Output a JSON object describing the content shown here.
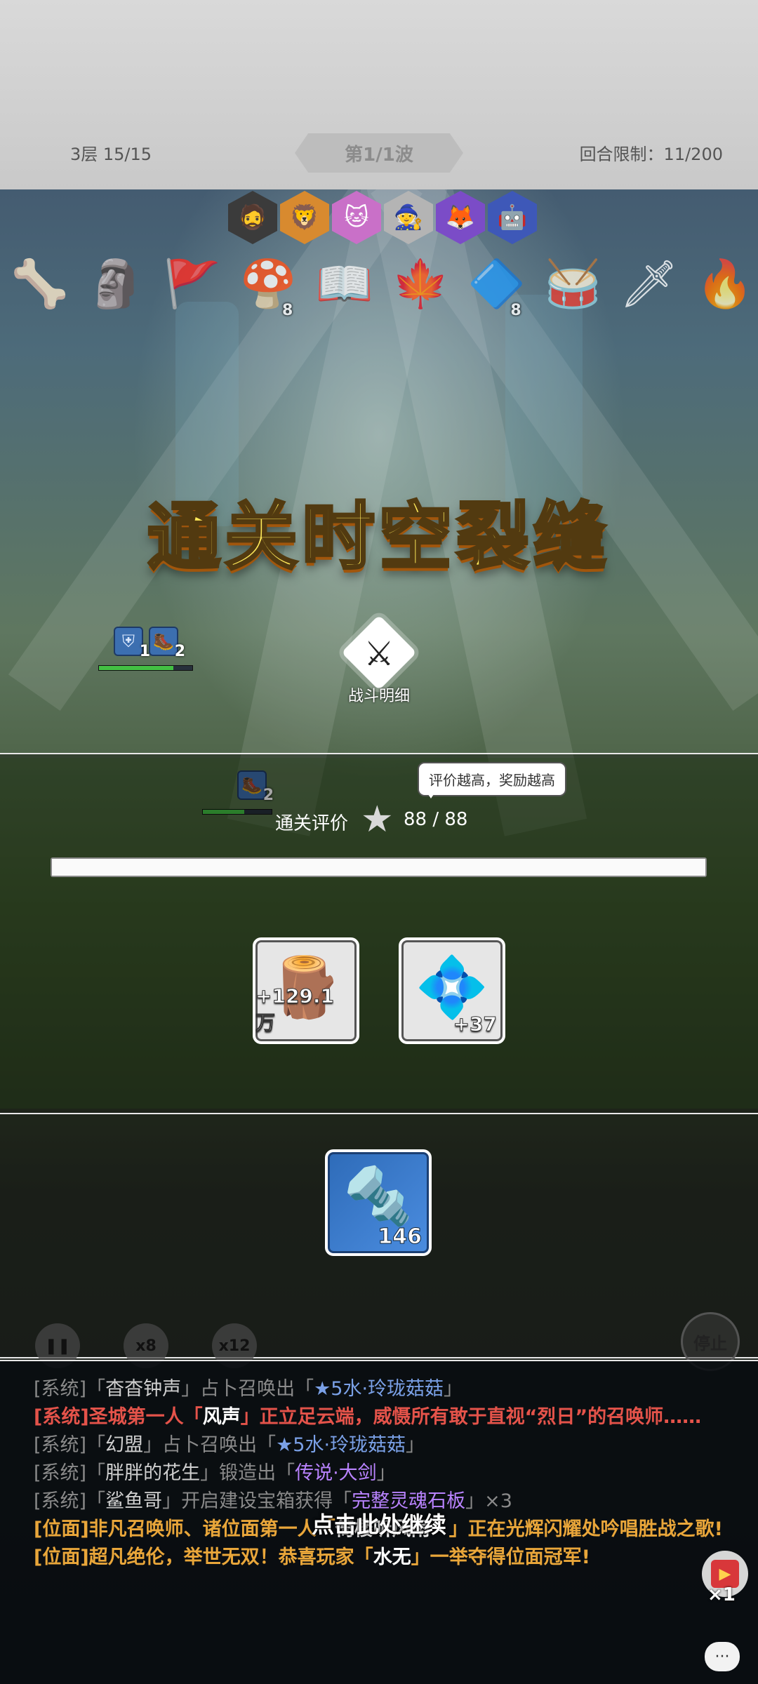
{
  "header": {
    "floor_info": "3层 15/15",
    "wave": "第1/1波",
    "round_limit": "回合限制：11/200"
  },
  "heroes": [
    {
      "icon": "🧔",
      "bg": "#3b3b3b"
    },
    {
      "icon": "🦁",
      "bg": "#d88a2f"
    },
    {
      "icon": "🐱",
      "bg": "#c970c8"
    },
    {
      "icon": "🧙",
      "bg": "#b4b4b4"
    },
    {
      "icon": "🦊",
      "bg": "#7b4cc7"
    },
    {
      "icon": "🤖",
      "bg": "#3e58b8"
    }
  ],
  "items": [
    {
      "icon": "🦴",
      "count": ""
    },
    {
      "icon": "🗿",
      "count": ""
    },
    {
      "icon": "🚩",
      "count": ""
    },
    {
      "icon": "🍄",
      "count": "8"
    },
    {
      "icon": "📖",
      "count": ""
    },
    {
      "icon": "🍁",
      "count": ""
    },
    {
      "icon": "🔷",
      "count": "8"
    },
    {
      "icon": "🥁",
      "count": ""
    },
    {
      "icon": "🗡",
      "count": ""
    },
    {
      "icon": "🔥",
      "count": ""
    }
  ],
  "banner": "通关时空裂缝",
  "battle_detail": {
    "icon": "⚔",
    "label": "战斗明细"
  },
  "badges": [
    {
      "icon": "⛨",
      "num": "1"
    },
    {
      "icon": "🥾",
      "num": "2"
    },
    {
      "icon": "🥾",
      "num": "2"
    }
  ],
  "result": {
    "tooltip": "评价越高，奖励越高",
    "rating_label": "通关评价",
    "star": "★",
    "rating_value": "88 / 88",
    "progress_fraction": 1.0
  },
  "rewards": [
    {
      "icon": "🪵",
      "amount": "+129.1万"
    },
    {
      "icon": "💠",
      "amount": "+37"
    }
  ],
  "bonus": {
    "icon": "🔩",
    "amount": "146"
  },
  "controls": {
    "pause": "❚❚",
    "speed8": "x8",
    "speed12": "x12",
    "stop": "停止"
  },
  "chat": [
    [
      {
        "t": "[系统]",
        "c": "gray"
      },
      {
        "t": "「",
        "c": "gray"
      },
      {
        "t": "杳杳钟声",
        "c": "light"
      },
      {
        "t": "」占卜召唤出「",
        "c": "gray"
      },
      {
        "t": "★5水·玲珑菇菇",
        "c": "blue"
      },
      {
        "t": "」",
        "c": "gray"
      }
    ],
    [
      {
        "t": "[系统]圣城第一人「",
        "c": "red"
      },
      {
        "t": "风声",
        "c": "white"
      },
      {
        "t": "」正立足云端，威慑所有敢于直视“烈日”的召唤师……",
        "c": "red"
      }
    ],
    [
      {
        "t": "[系统]",
        "c": "gray"
      },
      {
        "t": "「",
        "c": "gray"
      },
      {
        "t": "幻盟",
        "c": "light"
      },
      {
        "t": "」占卜召唤出「",
        "c": "gray"
      },
      {
        "t": "★5水·玲珑菇菇",
        "c": "blue"
      },
      {
        "t": "」",
        "c": "gray"
      }
    ],
    [
      {
        "t": "[系统]",
        "c": "gray"
      },
      {
        "t": "「",
        "c": "gray"
      },
      {
        "t": "胖胖的花生",
        "c": "light"
      },
      {
        "t": "」锻造出「",
        "c": "gray"
      },
      {
        "t": "传说·大剑",
        "c": "purple"
      },
      {
        "t": "」",
        "c": "gray"
      }
    ],
    [
      {
        "t": "[系统]",
        "c": "gray"
      },
      {
        "t": "「",
        "c": "gray"
      },
      {
        "t": "鲨鱼哥",
        "c": "light"
      },
      {
        "t": "」开启建设宝箱获得「",
        "c": "gray"
      },
      {
        "t": "完整灵魂石板",
        "c": "purple"
      },
      {
        "t": "」×3",
        "c": "gray"
      }
    ],
    [
      {
        "t": "[位面]非凡召唤师、诸位面第一人「",
        "c": "gold"
      },
      {
        "t": "倚楼听风雨丶",
        "c": "white"
      },
      {
        "t": "」正在光辉闪耀处吟唱胜战之歌!",
        "c": "gold"
      }
    ],
    [
      {
        "t": "[位面]超凡绝伦，举世无双！恭喜玩家「",
        "c": "gold"
      },
      {
        "t": "水无",
        "c": "white"
      },
      {
        "t": "」一举夺得位面冠军!",
        "c": "gold"
      }
    ]
  ],
  "continue_hint": "点击此处继续",
  "video": {
    "icon": "▶",
    "mult": "×1"
  },
  "chat_icon": "···"
}
